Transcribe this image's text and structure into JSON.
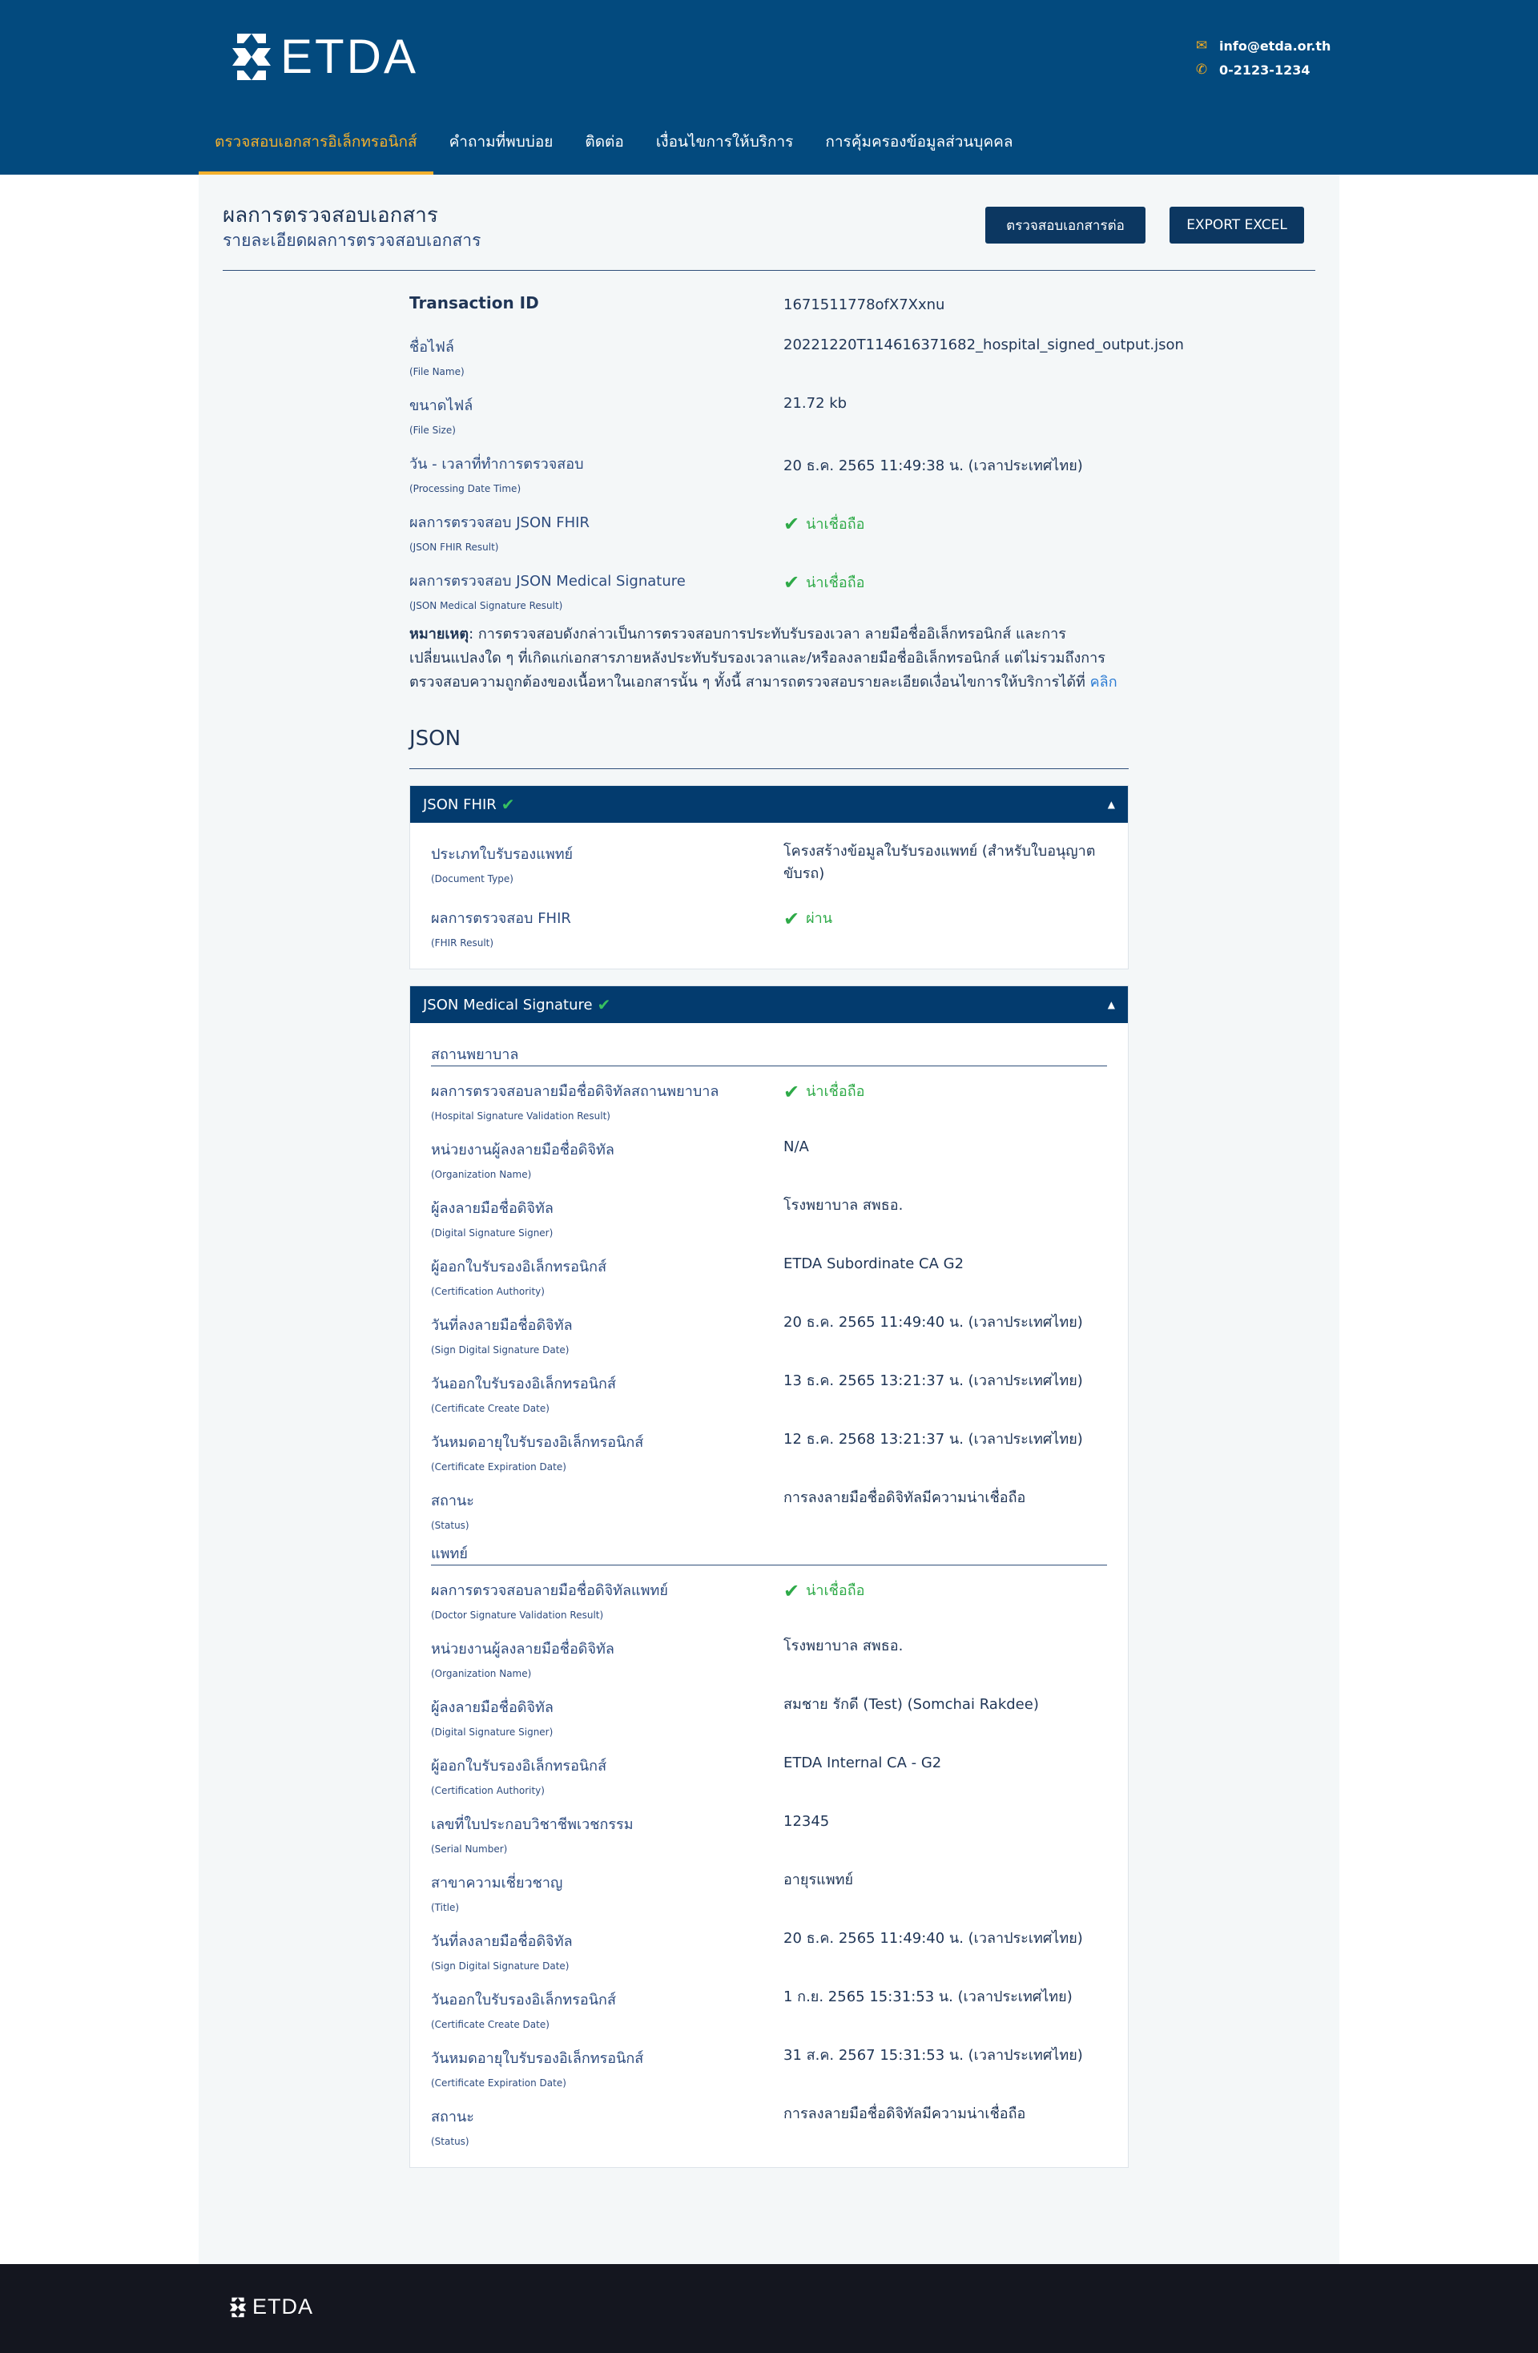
{
  "header": {
    "logo_text": "ETDA",
    "email": "info@etda.or.th",
    "phone": "0-2123-1234",
    "email_icon": "envelope-icon",
    "phone_icon": "phone-icon"
  },
  "nav": {
    "items": [
      "ตรวจสอบเอกสารอิเล็กทรอนิกส์",
      "คำถามที่พบบ่อย",
      "ติดต่อ",
      "เงื่อนไขการให้บริการ",
      "การคุ้มครองข้อมูลส่วนบุคคล"
    ]
  },
  "page": {
    "title": "ผลการตรวจสอบเอกสาร",
    "subtitle": "รายละเอียดผลการตรวจสอบเอกสาร",
    "verify_button": "ตรวจสอบเอกสารต่อ",
    "export_button": "EXPORT EXCEL"
  },
  "summary": {
    "transaction_label": "Transaction ID",
    "transaction_value": "1671511778ofX7Xxnu",
    "rows": [
      {
        "label": "ชื่อไฟล์",
        "sub": "(File Name)",
        "value": "20221220T114616371682_hospital_signed_output.json"
      },
      {
        "label": "ขนาดไฟล์",
        "sub": "(File Size)",
        "value": "21.72 kb"
      },
      {
        "label": "วัน - เวลาที่ทำการตรวจสอบ",
        "sub": "(Processing Date Time)",
        "value": "20 ธ.ค. 2565 11:49:38 น. (เวลาประเทศไทย)"
      },
      {
        "label": "ผลการตรวจสอบ JSON FHIR",
        "sub": "(JSON FHIR Result)",
        "value": "น่าเชื่อถือ"
      },
      {
        "label": "ผลการตรวจสอบ JSON Medical Signature",
        "sub": "(JSON Medical Signature Result)",
        "value": "น่าเชื่อถือ"
      }
    ]
  },
  "note": {
    "bold": "หมายเหตุ",
    "text": ": การตรวจสอบดังกล่าวเป็นการตรวจสอบการประทับรับรองเวลา ลายมือชื่ออิเล็กทรอนิกส์ และการเปลี่ยนแปลงใด ๆ ที่เกิดแก่เอกสารภายหลังประทับรับรองเวลาและ/หรือลงลายมือชื่ออิเล็กทรอนิกส์ แต่ไม่รวมถึงการตรวจสอบความถูกต้องของเนื้อหาในเอกสารนั้น ๆ ทั้งนี้ สามารถตรวจสอบรายละเอียดเงื่อนไขการให้บริการได้ที่ ",
    "link": "คลิก"
  },
  "json_section": {
    "title": "JSON"
  },
  "fhir_panel": {
    "title": "JSON FHIR",
    "rows": [
      {
        "label": "ประเภทใบรับรองแพทย์",
        "sub": "(Document Type)",
        "value": "โครงสร้างข้อมูลใบรับรองแพทย์ (สำหรับใบอนุญาตขับรถ)"
      },
      {
        "label": "ผลการตรวจสอบ FHIR",
        "sub": "(FHIR Result)",
        "value": "ผ่าน"
      }
    ]
  },
  "signature_panel": {
    "title": "JSON Medical Signature",
    "hospital_label": "สถานพยาบาล",
    "hospital_rows": [
      {
        "label": "ผลการตรวจสอบลายมือชื่อดิจิทัลสถานพยาบาล",
        "sub": "(Hospital Signature Validation Result)",
        "value": "น่าเชื่อถือ"
      },
      {
        "label": "หน่วยงานผู้ลงลายมือชื่อดิจิทัล",
        "sub": "(Organization Name)",
        "value": "N/A"
      },
      {
        "label": "ผู้ลงลายมือชื่อดิจิทัล",
        "sub": "(Digital Signature Signer)",
        "value": "โรงพยาบาล สพธอ."
      },
      {
        "label": "ผู้ออกใบรับรองอิเล็กทรอนิกส์",
        "sub": "(Certification Authority)",
        "value": "ETDA Subordinate CA G2"
      },
      {
        "label": "วันที่ลงลายมือชื่อดิจิทัล",
        "sub": "(Sign Digital Signature Date)",
        "value": "20 ธ.ค. 2565 11:49:40 น. (เวลาประเทศไทย)"
      },
      {
        "label": "วันออกใบรับรองอิเล็กทรอนิกส์",
        "sub": "(Certificate Create Date)",
        "value": "13 ธ.ค. 2565 13:21:37 น. (เวลาประเทศไทย)"
      },
      {
        "label": "วันหมดอายุใบรับรองอิเล็กทรอนิกส์",
        "sub": "(Certificate Expiration Date)",
        "value": "12 ธ.ค. 2568 13:21:37 น. (เวลาประเทศไทย)"
      },
      {
        "label": "สถานะ",
        "sub": "(Status)",
        "value": "การลงลายมือชื่อดิจิทัลมีความน่าเชื่อถือ"
      }
    ],
    "doctor_label": "แพทย์",
    "doctor_rows": [
      {
        "label": "ผลการตรวจสอบลายมือชื่อดิจิทัลแพทย์",
        "sub": "(Doctor Signature Validation Result)",
        "value": "น่าเชื่อถือ"
      },
      {
        "label": "หน่วยงานผู้ลงลายมือชื่อดิจิทัล",
        "sub": "(Organization Name)",
        "value": "โรงพยาบาล สพธอ."
      },
      {
        "label": "ผู้ลงลายมือชื่อดิจิทัล",
        "sub": "(Digital Signature Signer)",
        "value": "สมชาย รักดี (Test) (Somchai Rakdee)"
      },
      {
        "label": "ผู้ออกใบรับรองอิเล็กทรอนิกส์",
        "sub": "(Certification Authority)",
        "value": "ETDA Internal CA - G2"
      },
      {
        "label": "เลขที่ใบประกอบวิชาชีพเวชกรรม",
        "sub": "(Serial Number)",
        "value": "12345"
      },
      {
        "label": "สาขาความเชี่ยวชาญ",
        "sub": "(Title)",
        "value": "อายุรแพทย์"
      },
      {
        "label": "วันที่ลงลายมือชื่อดิจิทัล",
        "sub": "(Sign Digital Signature Date)",
        "value": "20 ธ.ค. 2565 11:49:40 น. (เวลาประเทศไทย)"
      },
      {
        "label": "วันออกใบรับรองอิเล็กทรอนิกส์",
        "sub": "(Certificate Create Date)",
        "value": "1 ก.ย. 2565 15:31:53 น. (เวลาประเทศไทย)"
      },
      {
        "label": "วันหมดอายุใบรับรองอิเล็กทรอนิกส์",
        "sub": "(Certificate Expiration Date)",
        "value": "31 ส.ค. 2567 15:31:53 น. (เวลาประเทศไทย)"
      },
      {
        "label": "สถานะ",
        "sub": "(Status)",
        "value": "การลงลายมือชื่อดิจิทัลมีความน่าเชื่อถือ"
      }
    ]
  },
  "footer": {
    "logo_text": "ETDA"
  },
  "colors": {
    "header_bg": "#034a7e",
    "accent": "#f3b02e",
    "button_bg": "#0c3761",
    "success": "#2eaa48",
    "footer_bg": "#14161f"
  }
}
